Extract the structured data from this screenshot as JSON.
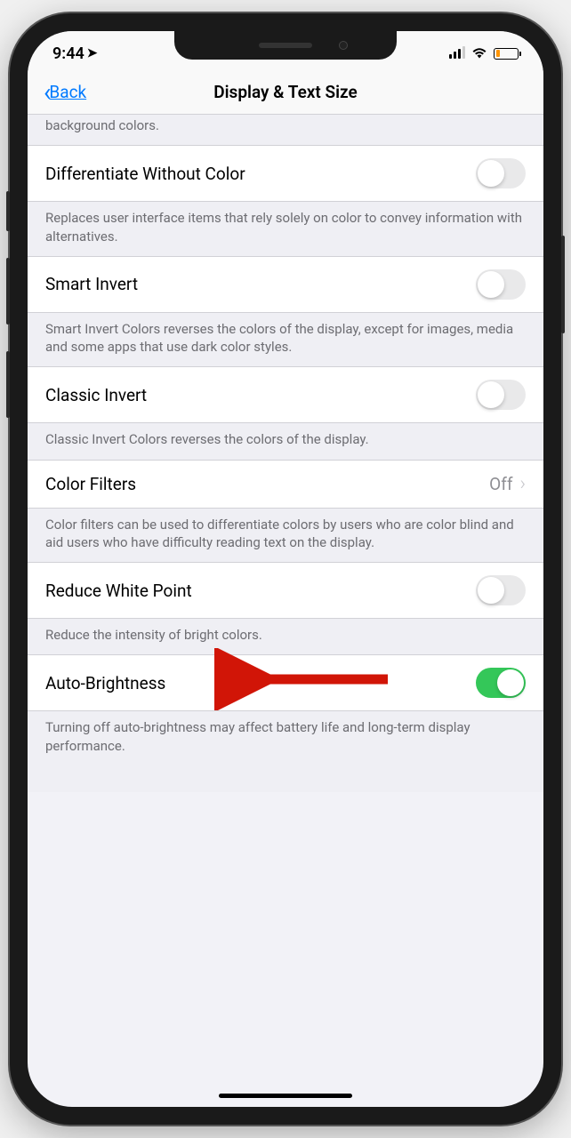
{
  "statusBar": {
    "time": "9:44"
  },
  "nav": {
    "back": "Back",
    "title": "Display & Text Size"
  },
  "sections": {
    "truncatedTop": "background colors.",
    "differentiate": {
      "label": "Differentiate Without Color",
      "footer": "Replaces user interface items that rely solely on color to convey information with alternatives.",
      "enabled": false
    },
    "smartInvert": {
      "label": "Smart Invert",
      "footer": "Smart Invert Colors reverses the colors of the display, except for images, media and some apps that use dark color styles.",
      "enabled": false
    },
    "classicInvert": {
      "label": "Classic Invert",
      "footer": "Classic Invert Colors reverses the colors of the display.",
      "enabled": false
    },
    "colorFilters": {
      "label": "Color Filters",
      "value": "Off",
      "footer": "Color filters can be used to differentiate colors by users who are color blind and aid users who have difficulty reading text on the display."
    },
    "reduceWhite": {
      "label": "Reduce White Point",
      "footer": "Reduce the intensity of bright colors.",
      "enabled": false
    },
    "autoBrightness": {
      "label": "Auto-Brightness",
      "footer": "Turning off auto-brightness may affect battery life and long-term display performance.",
      "enabled": true
    }
  }
}
